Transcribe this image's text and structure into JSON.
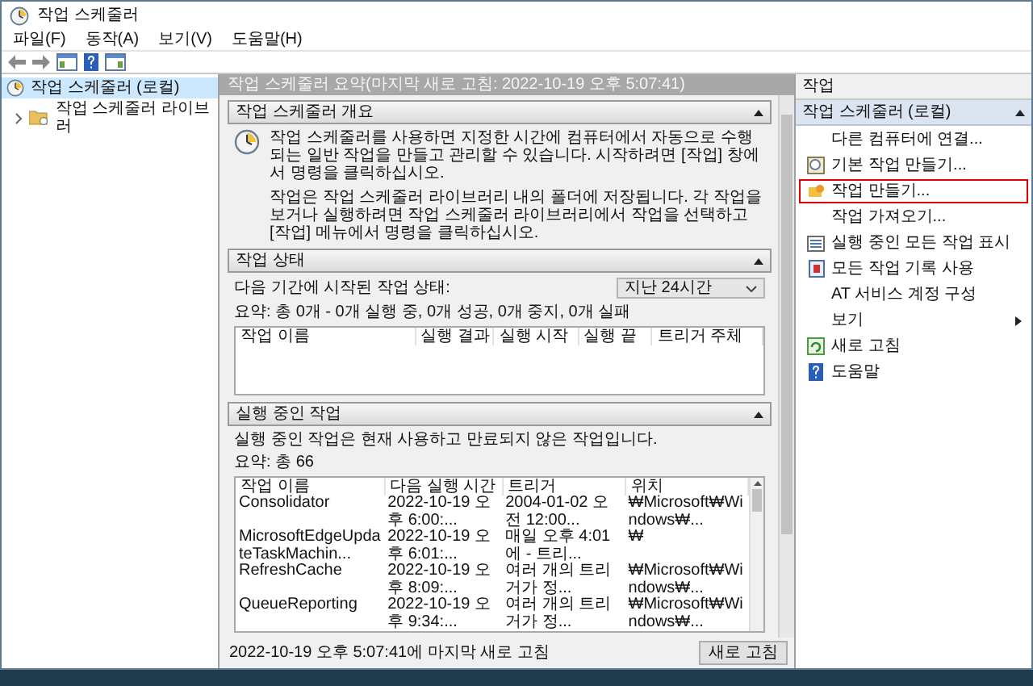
{
  "window": {
    "title": "작업 스케줄러"
  },
  "menu": [
    "파일(F)",
    "동작(A)",
    "보기(V)",
    "도움말(H)"
  ],
  "tree": [
    {
      "label": "작업 스케줄러 (로컬)",
      "selected": true,
      "children": [
        {
          "label": "작업 스케줄러 라이브러",
          "selected": false,
          "expanded": false
        }
      ]
    }
  ],
  "summary_bar": "작업 스케줄러 요약(마지막 새로 고침: 2022-10-19 오후 5:07:41)",
  "overview": {
    "title": "작업 스케줄러 개요",
    "expanded": true,
    "paragraphs": [
      "작업 스케줄러를 사용하면 지정한 시간에 컴퓨터에서 자동으로 수행되는 일반 작업을 만들고 관리할 수 있습니다. 시작하려면 [작업] 창에서 명령을 클릭하십시오.",
      "작업은 작업 스케줄러 라이브러리 내의 폴더에 저장됩니다. 각 작업을 보거나 실행하려면 작업 스케줄러 라이브러리에서 작업을 선택하고 [작업] 메뉴에서 명령을 클릭하십시오."
    ]
  },
  "task_status": {
    "title": "작업 상태",
    "expanded": true,
    "period_label": "다음 기간에 시작된 작업 상태:",
    "period": "지난 24시간",
    "summary": "요약: 총 0개 - 0개 실행 중, 0개 성공, 0개 중지, 0개 실패",
    "columns": [
      "작업 이름",
      "실행 결과",
      "실행 시작",
      "실행 끝",
      "트리거 주체"
    ]
  },
  "running_tasks": {
    "title": "실행 중인 작업",
    "expanded": true,
    "description": "실행 중인 작업은 현재 사용하고 만료되지 않은 작업입니다.",
    "summary": "요약: 총 66",
    "columns": [
      "작업 이름",
      "다음 실행 시간",
      "트리거",
      "위치"
    ],
    "rows": [
      [
        "Consolidator",
        "2022-10-19 오후 6:00:...",
        "2004-01-02 오전 12:00...",
        "₩Microsoft₩Windows₩..."
      ],
      [
        "MicrosoftEdgeUpdateTaskMachin...",
        "2022-10-19 오후 6:01:...",
        "매일 오후 4:01에 - 트리...",
        "₩"
      ],
      [
        "RefreshCache",
        "2022-10-19 오후 8:09:...",
        "여러 개의 트리거가 정...",
        "₩Microsoft₩Windows₩..."
      ],
      [
        "QueueReporting",
        "2022-10-19 오후 9:34:...",
        "여러 개의 트리거가 정...",
        "₩Microsoft₩Windows₩..."
      ]
    ]
  },
  "status_bar": {
    "text": "2022-10-19 오후 5:07:41에 마지막 새로 고침",
    "button": "새로 고침"
  },
  "actions": {
    "title": "작업",
    "group": {
      "label": "작업 스케줄러 (로컬)",
      "expanded": true
    },
    "items": [
      {
        "label": "다른 컴퓨터에 연결...",
        "kind": "plain",
        "highlighted": false
      },
      {
        "label": "기본 작업 만들기...",
        "kind": "wizard",
        "highlighted": false
      },
      {
        "label": "작업 만들기...",
        "kind": "create",
        "highlighted": true
      },
      {
        "label": "작업 가져오기...",
        "kind": "plain",
        "highlighted": false
      },
      {
        "label": "실행 중인 모든 작업 표시",
        "kind": "running",
        "highlighted": false
      },
      {
        "label": "모든 작업 기록 사용",
        "kind": "history",
        "highlighted": false
      },
      {
        "label": "AT 서비스 계정 구성",
        "kind": "plain",
        "highlighted": false
      },
      {
        "label": "보기",
        "kind": "submenu",
        "highlighted": false
      },
      {
        "label": "새로 고침",
        "kind": "refresh",
        "highlighted": false
      },
      {
        "label": "도움말",
        "kind": "help",
        "highlighted": false
      }
    ]
  }
}
